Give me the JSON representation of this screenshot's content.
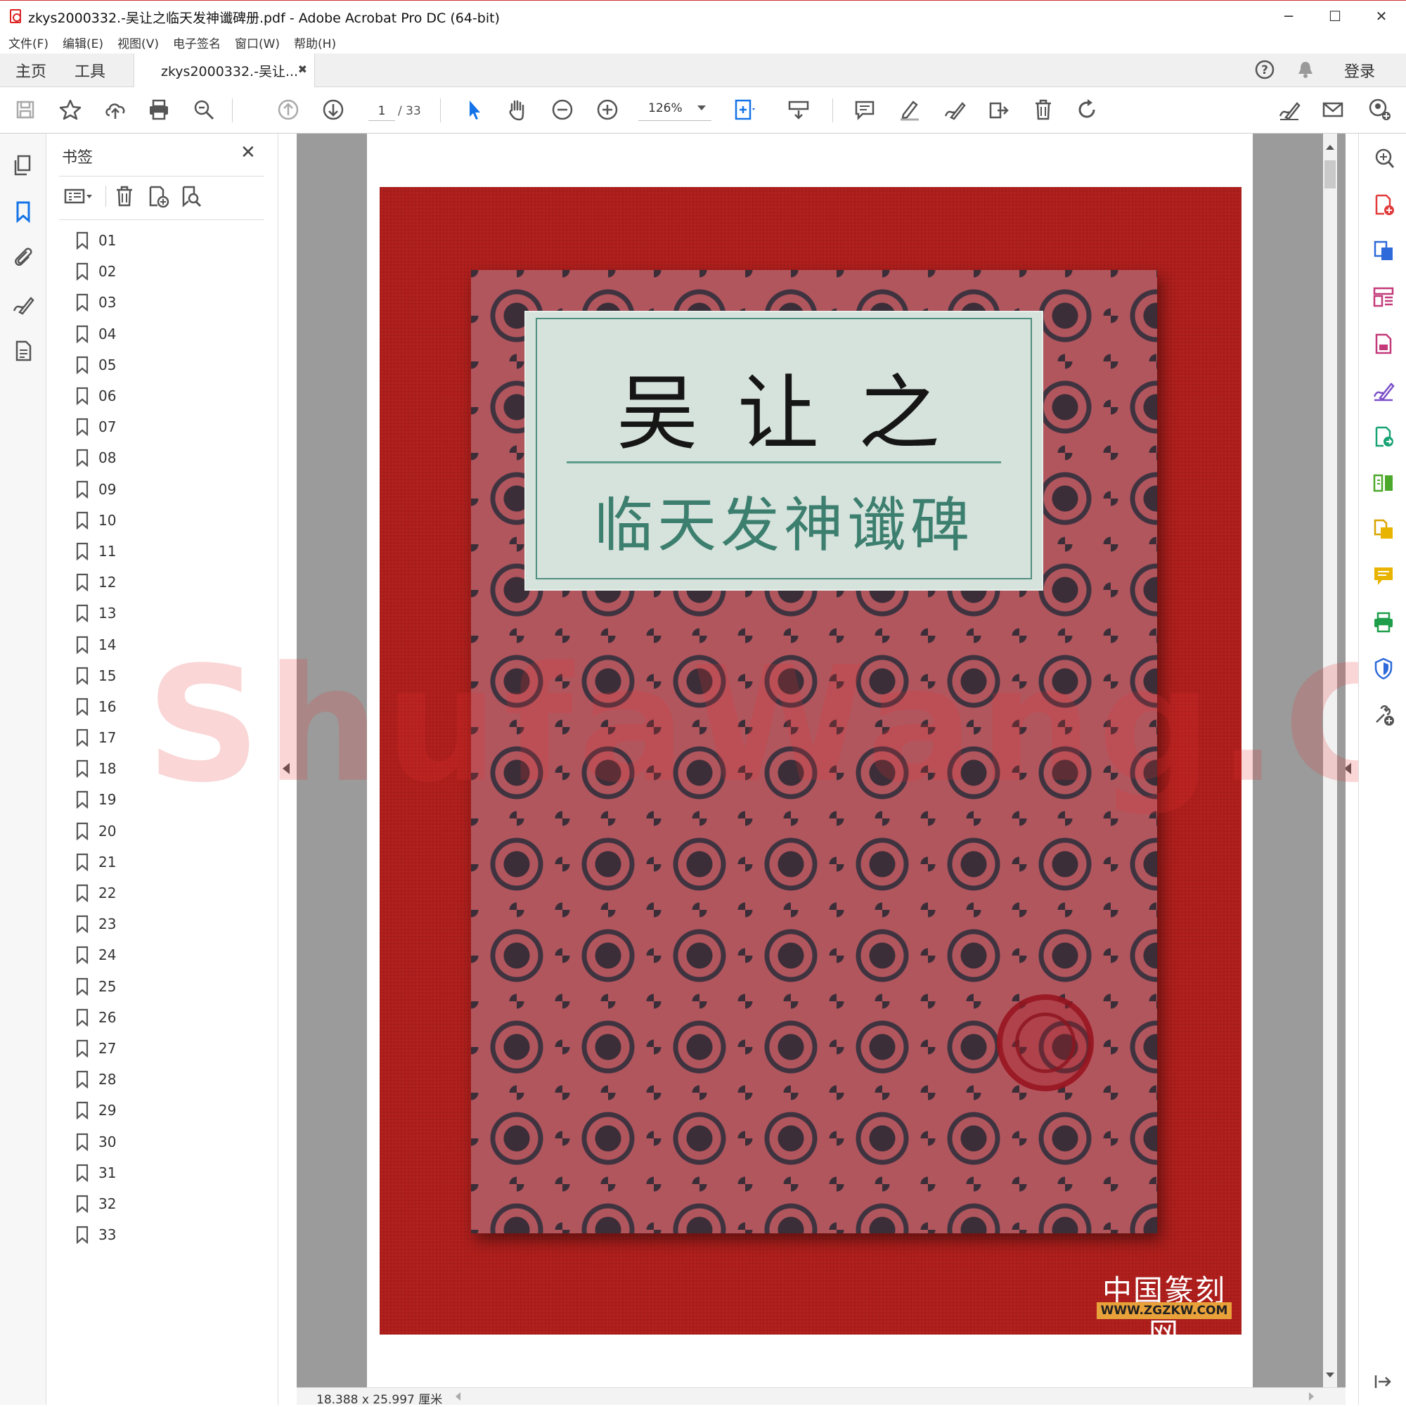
{
  "window": {
    "title": "zkys2000332.-吴让之临天发神谶碑册.pdf - Adobe Acrobat Pro DC (64-bit)",
    "minimize": "─",
    "maximize": "☐",
    "close": "✕"
  },
  "menu": [
    "文件(F)",
    "编辑(E)",
    "视图(V)",
    "电子签名",
    "窗口(W)",
    "帮助(H)"
  ],
  "tabs": {
    "home": "主页",
    "tools": "工具",
    "document": "zkys2000332.-吴让...",
    "document_close": "✖",
    "signin": "登录"
  },
  "toolbar": {
    "page_current": "1",
    "page_total": "/ 33",
    "zoom": "126%"
  },
  "bookmarks": {
    "title": "书签",
    "close": "✕",
    "items": [
      "01",
      "02",
      "03",
      "04",
      "05",
      "06",
      "07",
      "08",
      "09",
      "10",
      "11",
      "12",
      "13",
      "14",
      "15",
      "16",
      "17",
      "18",
      "19",
      "20",
      "21",
      "22",
      "23",
      "24",
      "25",
      "26",
      "27",
      "28",
      "29",
      "30",
      "31",
      "32",
      "33"
    ]
  },
  "document": {
    "cover_author": "吴让之",
    "cover_title": "临天发神谶碑",
    "logo_text": "中国篆刻网",
    "logo_url": "WWW.ZGZKW.COM",
    "watermark": "ShufaWang.CN"
  },
  "status": {
    "page_size": "18.388 x 25.997 厘米"
  },
  "colors": {
    "accent_blue": "#1473e6",
    "acrobat_red": "#d7282f",
    "photo_red": "#b3201d",
    "cover_pink": "#b2565e",
    "label_teal": "#3c7f6f"
  }
}
